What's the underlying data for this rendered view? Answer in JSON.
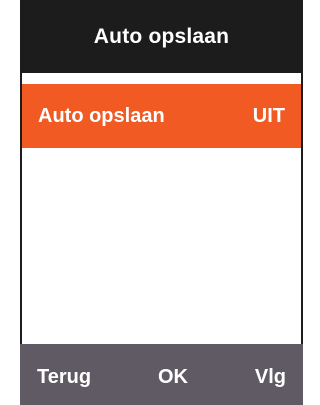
{
  "header": {
    "title": "Auto opslaan"
  },
  "menu": {
    "items": [
      {
        "label": "Auto opslaan",
        "value": "UIT"
      }
    ]
  },
  "softkeys": {
    "back": "Terug",
    "ok": "OK",
    "next": "Vlg"
  },
  "colors": {
    "title_bar": "#1c1c1c",
    "selected_item": "#f15a22",
    "softkey_bar": "#5f5a63",
    "text": "#ffffff",
    "background": "#ffffff"
  }
}
